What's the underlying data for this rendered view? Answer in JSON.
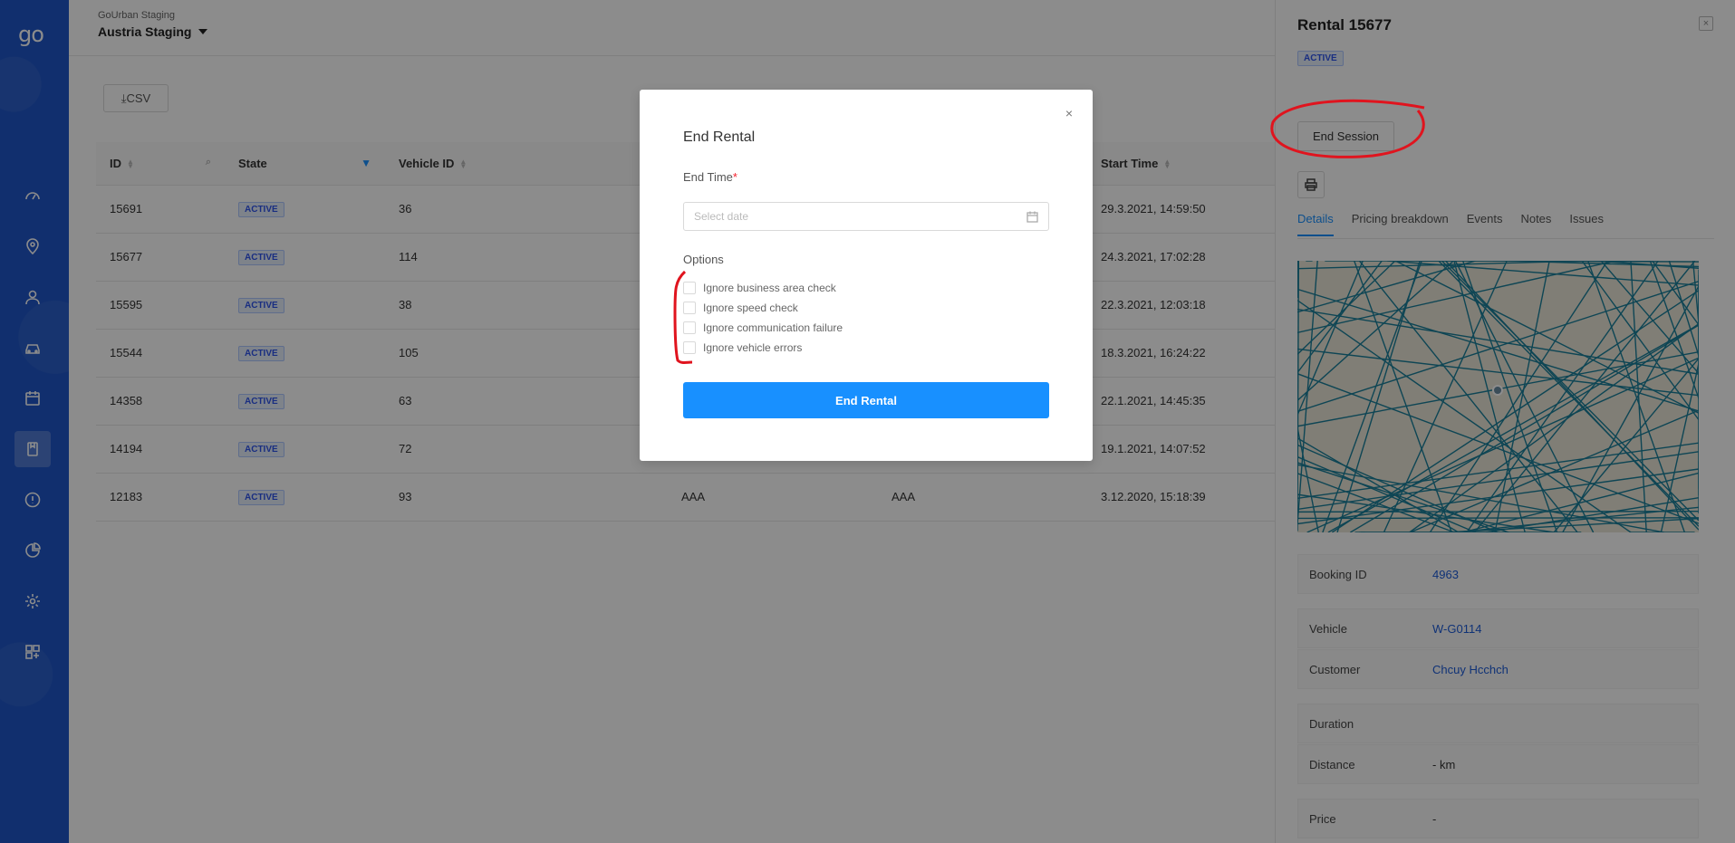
{
  "sidebar": {
    "logo": "go",
    "items": [
      {
        "icon": "dashboard-icon"
      },
      {
        "icon": "location-pin-icon"
      },
      {
        "icon": "users-icon"
      },
      {
        "icon": "car-icon"
      },
      {
        "icon": "calendar-icon"
      },
      {
        "icon": "rentals-icon",
        "active": true
      },
      {
        "icon": "alert-icon"
      },
      {
        "icon": "pie-chart-icon"
      },
      {
        "icon": "gear-icon"
      },
      {
        "icon": "apps-icon"
      }
    ]
  },
  "header": {
    "org_small": "GoUrban Staging",
    "org_big": "Austria Staging"
  },
  "toolbar": {
    "csv_label": "CSV"
  },
  "table": {
    "columns": [
      "ID",
      "State",
      "Vehicle ID",
      "Start Time"
    ],
    "rows": [
      {
        "id": "15691",
        "state": "ACTIVE",
        "vehicle": "36",
        "c4": "",
        "c5": "",
        "start": "29.3.2021, 14:59:50"
      },
      {
        "id": "15677",
        "state": "ACTIVE",
        "vehicle": "114",
        "c4": "",
        "c5": "",
        "start": "24.3.2021, 17:02:28"
      },
      {
        "id": "15595",
        "state": "ACTIVE",
        "vehicle": "38",
        "c4": "",
        "c5": "",
        "start": "22.3.2021, 12:03:18"
      },
      {
        "id": "15544",
        "state": "ACTIVE",
        "vehicle": "105",
        "c4": "",
        "c5": "",
        "start": "18.3.2021, 16:24:22"
      },
      {
        "id": "14358",
        "state": "ACTIVE",
        "vehicle": "63",
        "c4": "",
        "c5": "",
        "start": "22.1.2021, 14:45:35"
      },
      {
        "id": "14194",
        "state": "ACTIVE",
        "vehicle": "72",
        "c4": "",
        "c5": "",
        "start": "19.1.2021, 14:07:52"
      },
      {
        "id": "12183",
        "state": "ACTIVE",
        "vehicle": "93",
        "c4": "AAA",
        "c5": "AAA",
        "start": "3.12.2020, 15:18:39"
      }
    ]
  },
  "panel": {
    "title": "Rental 15677",
    "close": "×",
    "badge": "ACTIVE",
    "end_session": "End Session",
    "tabs": [
      "Details",
      "Pricing breakdown",
      "Events",
      "Notes",
      "Issues"
    ],
    "details": [
      {
        "key": "Booking ID",
        "value": "4963",
        "link": true
      },
      {
        "key": "Vehicle",
        "value": "W-G0114",
        "link": true
      },
      {
        "key": "Customer",
        "value": "Chcuy Hcchch",
        "link": true
      },
      {
        "key": "Duration",
        "value": "",
        "link": false
      },
      {
        "key": "Distance",
        "value": "- km",
        "link": false
      },
      {
        "key": "Price",
        "value": "-",
        "link": false
      }
    ]
  },
  "modal": {
    "title": "End Rental",
    "close": "×",
    "end_time_label": "End Time",
    "required_mark": "*",
    "date_placeholder": "Select date",
    "options_label": "Options",
    "options": [
      "Ignore business area check",
      "Ignore speed check",
      "Ignore communication failure",
      "Ignore vehicle errors"
    ],
    "submit": "End Rental"
  },
  "colors": {
    "sidebar": "#1f56c8",
    "primary": "#1890ff",
    "annotation": "#e0141e"
  }
}
